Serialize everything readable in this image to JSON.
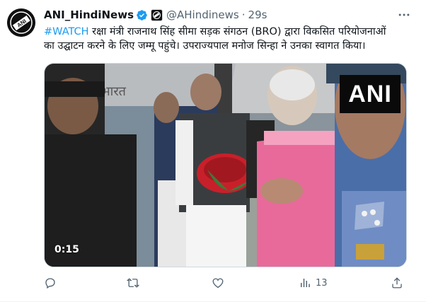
{
  "tweet": {
    "author_name": "ANI_HindiNews",
    "handle": "@AHindinews",
    "separator": "·",
    "time": "29s",
    "hashtag": "#WATCH",
    "text_line1": "रक्षा मंत्री राजनाथ सिंह सीमा सड़क संगठन (BRO) द्वारा विकसित परियोजनाओं",
    "text_line2": "का उद्घाटन करने के लिए जम्मू पहुंचे। उपराज्यपाल मनोज सिन्हा ने उनका स्वागत किया।",
    "avatar_text": "ANI",
    "media": {
      "watermark": "ANI",
      "duration": "0:15",
      "sign_text": "भारत"
    },
    "actions": {
      "reply_count": "",
      "retweet_count": "",
      "like_count": "",
      "views_count": "13"
    }
  },
  "colors": {
    "accent": "#1d9bf0",
    "secondary_text": "#536471",
    "verified": "#1d9bf0"
  },
  "icons": [
    "verified-badge-icon",
    "affiliate-badge-icon",
    "more-icon",
    "reply-icon",
    "retweet-icon",
    "like-icon",
    "views-icon",
    "share-icon"
  ]
}
